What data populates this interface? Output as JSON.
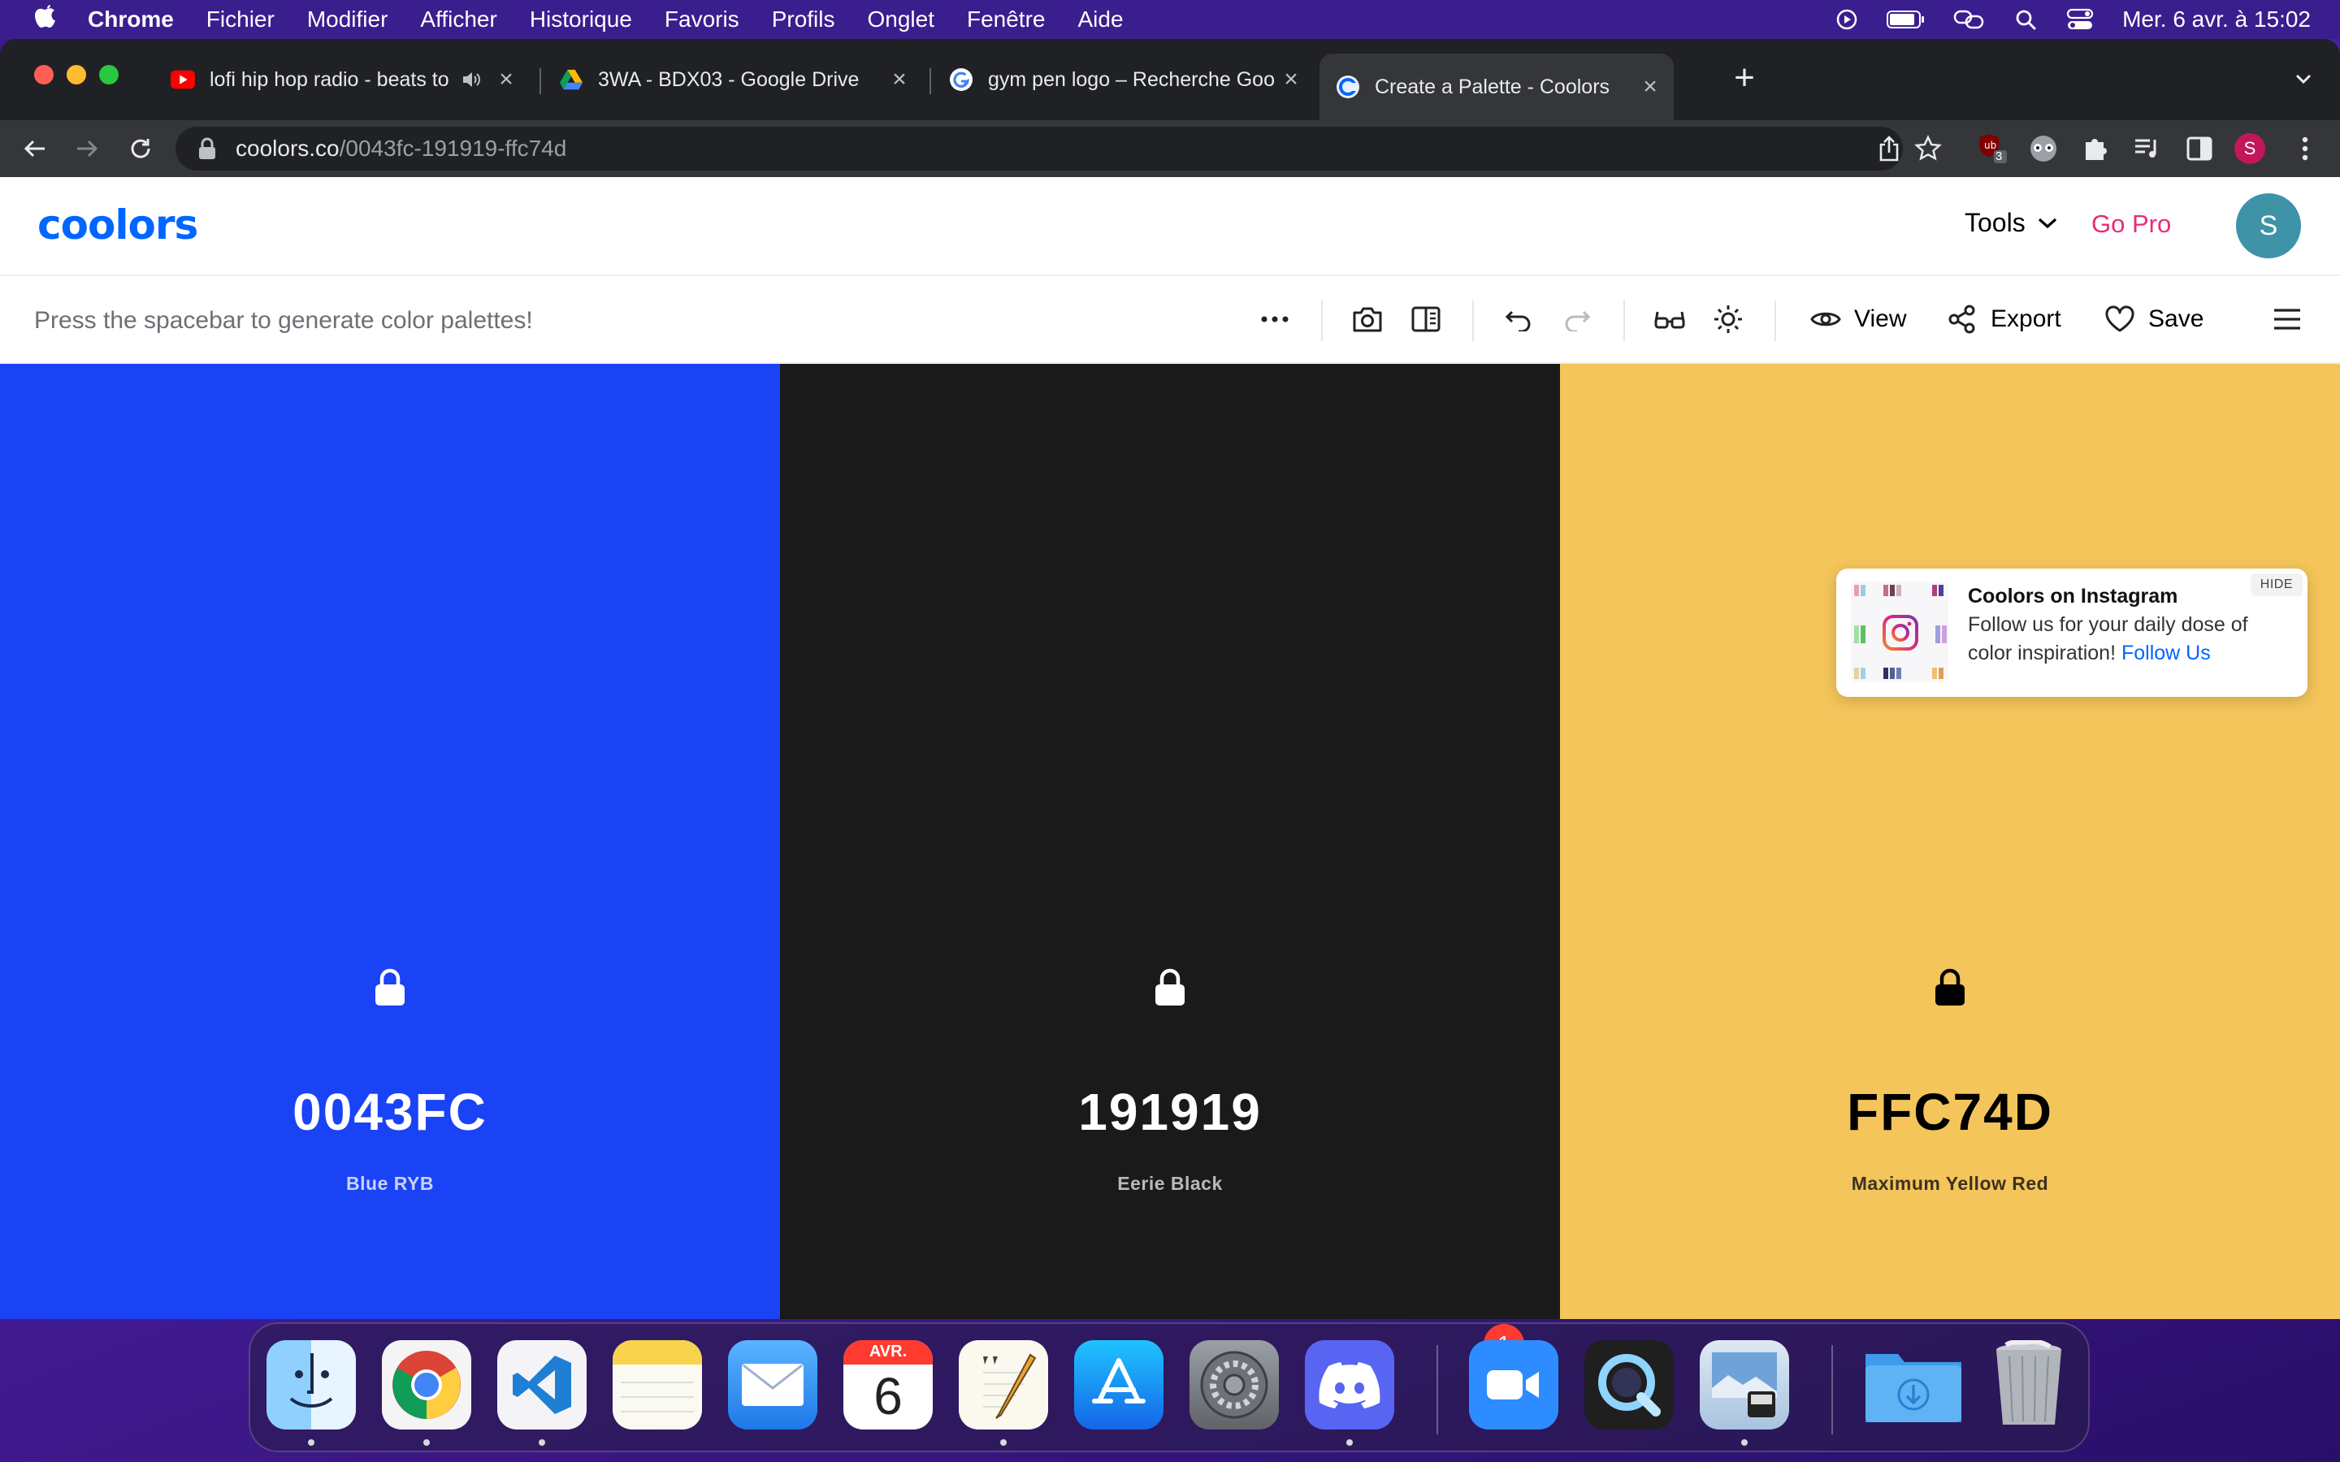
{
  "menubar": {
    "apple_icon": "apple-icon",
    "items": [
      "Chrome",
      "Fichier",
      "Modifier",
      "Afficher",
      "Historique",
      "Favoris",
      "Profils",
      "Onglet",
      "Fenêtre",
      "Aide"
    ],
    "clock": "Mer. 6 avr. à  15:02"
  },
  "browser": {
    "tabs": [
      {
        "title": "lofi hip hop radio - beats to",
        "favicon": "youtube-icon",
        "muted_icon": "speaker-icon"
      },
      {
        "title": "3WA - BDX03 - Google Drive",
        "favicon": "google-drive-icon"
      },
      {
        "title": "gym pen logo – Recherche Goo",
        "favicon": "google-icon"
      },
      {
        "title": "Create a Palette - Coolors",
        "favicon": "coolors-icon",
        "active": true
      }
    ],
    "new_tab": "+",
    "url_domain": "coolors.co",
    "url_path": "/0043fc-191919-ffc74d",
    "extension_badge": "3",
    "profile_initial": "S"
  },
  "site": {
    "logo": "coolors",
    "tools_label": "Tools",
    "gopro_label": "Go Pro",
    "avatar_initial": "S",
    "hint": "Press the spacebar to generate color palettes!",
    "view_label": "View",
    "export_label": "Export",
    "save_label": "Save"
  },
  "palette": {
    "colors": [
      {
        "hex": "0043FC",
        "name": "Blue RYB",
        "bg": "#1a43f5",
        "text": "#ffffff",
        "sub": "#c9d2ff"
      },
      {
        "hex": "191919",
        "name": "Eerie Black",
        "bg": "#1a1a1a",
        "text": "#ffffff",
        "sub": "#b9b9b9"
      },
      {
        "hex": "FFC74D",
        "name": "Maximum Yellow Red",
        "bg": "#f4c55a",
        "text": "#000000",
        "sub": "#3d3220"
      }
    ]
  },
  "promo": {
    "title": "Coolors on Instagram",
    "desc": "Follow us for your daily dose of color inspiration!",
    "follow": "Follow Us",
    "hide": "HIDE"
  },
  "dock": {
    "apps": [
      "finder",
      "chrome",
      "vscode",
      "notes",
      "mail",
      "calendar",
      "textedit",
      "app-store",
      "system-preferences",
      "discord",
      "zoom",
      "quicktime",
      "preview",
      "downloads",
      "trash"
    ],
    "calendar_month": "AVR.",
    "calendar_day": "6",
    "notification_count": "1"
  }
}
